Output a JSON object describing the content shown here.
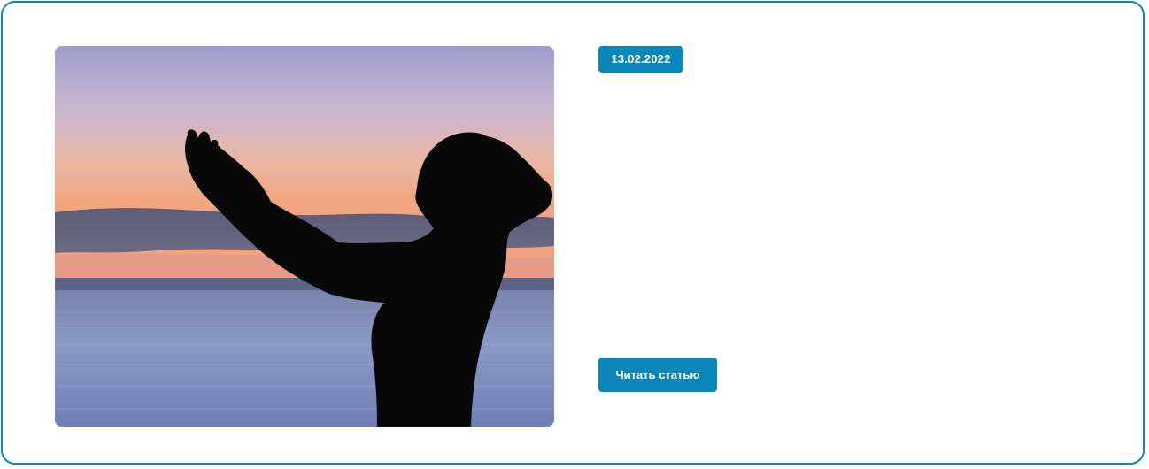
{
  "article": {
    "date": "13.02.2022",
    "read_button_label": "Читать статью"
  },
  "colors": {
    "accent": "#0a86b8",
    "border": "#0a86b8",
    "background": "#ffffff"
  },
  "icons": {
    "image": "silhouette-sunset-photo"
  }
}
